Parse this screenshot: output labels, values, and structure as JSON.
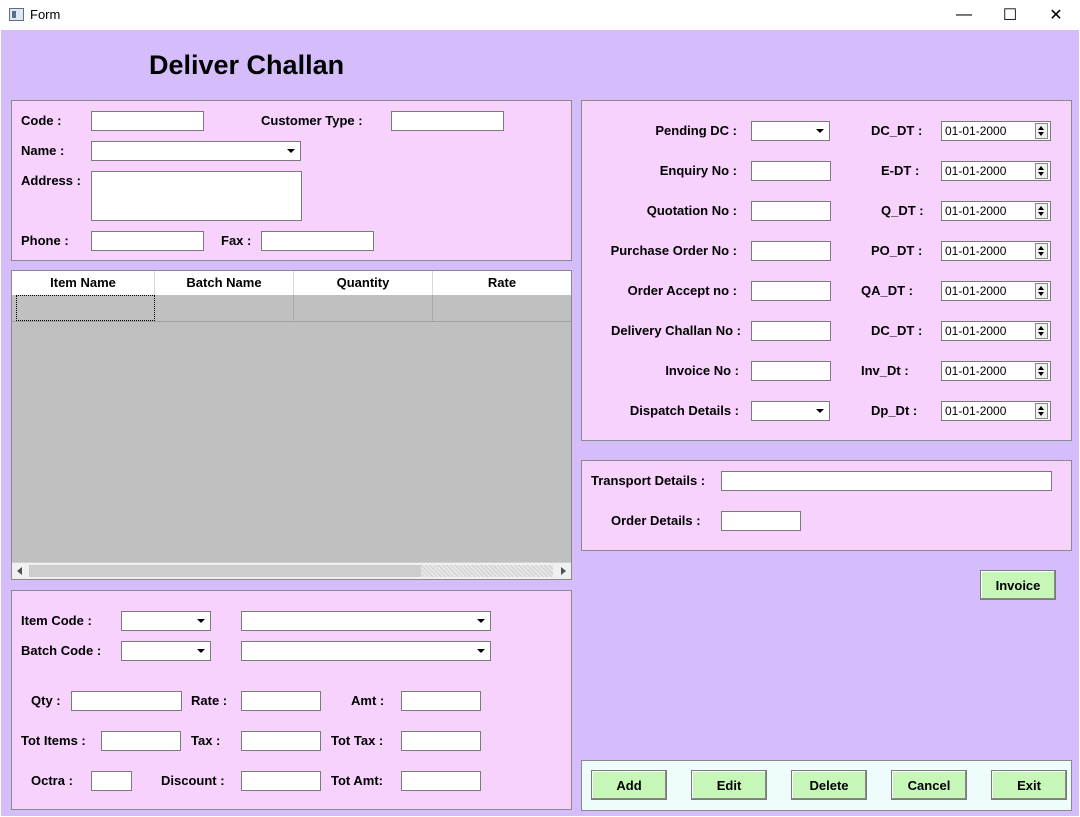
{
  "window": {
    "title": "Form",
    "minimize": "—",
    "maximize": "☐",
    "close": "✕"
  },
  "heading": "Deliver Challan",
  "customer": {
    "code_label": "Code :",
    "customer_type_label": "Customer Type :",
    "name_label": "Name :",
    "address_label": "Address :",
    "phone_label": "Phone :",
    "fax_label": "Fax :"
  },
  "grid": {
    "columns": [
      "Item Name",
      "Batch Name",
      "Quantity",
      "Rate"
    ]
  },
  "dates": {
    "pending_dc_label": "Pending DC :",
    "dc_dt_label": "DC_DT  :",
    "enquiry_no_label": "Enquiry No  :",
    "e_dt_label": "E-DT  :",
    "quotation_no_label": "Quotation No :",
    "q_dt_label": "Q_DT :",
    "purchase_order_label": "Purchase Order  No :",
    "po_dt_label": "PO_DT :",
    "order_accept_label": "Order Accept no   :",
    "qa_dt_label": "QA_DT  :",
    "delivery_challan_label": "Delivery Challan No  :",
    "dc_dt2_label": "DC_DT :",
    "invoice_no_label": "Invoice No :",
    "inv_dt_label": "Inv_Dt  :",
    "dispatch_label": "Dispatch Details :",
    "dp_dt_label": "Dp_Dt  :",
    "date_values": [
      "01-01-2000",
      "01-01-2000",
      "01-01-2000",
      "01-01-2000",
      "01-01-2000",
      "01-01-2000",
      "01-01-2000",
      "01-01-2000"
    ]
  },
  "transport": {
    "transport_label": "Transport Details :",
    "order_label": "Order Details  :"
  },
  "invoice_button": "Invoice",
  "item": {
    "item_code_label": "Item Code   :",
    "batch_code_label": "Batch Code :",
    "qty_label": "Qty :",
    "rate_label": "Rate :",
    "amt_label": "Amt :",
    "tot_items_label": "Tot Items :",
    "tax_label": "Tax   :",
    "tot_tax_label": "Tot Tax :",
    "octra_label": "Octra :",
    "discount_label": "Discount  :",
    "tot_amt_label": "Tot Amt:"
  },
  "actions": {
    "add": "Add",
    "edit": "Edit",
    "delete": "Delete",
    "cancel": "Cancel",
    "exit": "Exit"
  },
  "colors": {
    "client_bg": "#d5bcfb",
    "panel_bg": "#f6d2fd",
    "button_bg": "#c6f7b9",
    "action_panel_bg": "#eefcfc"
  }
}
